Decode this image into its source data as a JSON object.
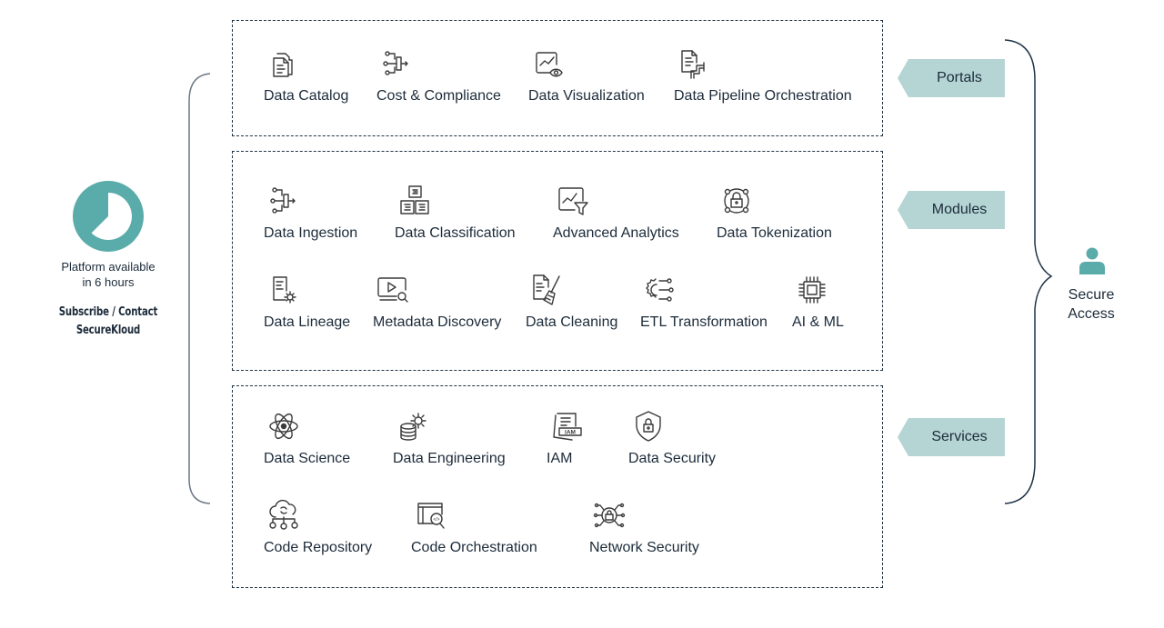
{
  "left_panel": {
    "clock_icon": "clock-pie-icon",
    "availability_text_line1": "Platform available",
    "availability_text_line2": "in 6 hours",
    "cta_line1": "Subscribe / Contact",
    "cta_line2": "SecureKloud"
  },
  "sections": {
    "portals": {
      "tag": "Portals",
      "items": [
        {
          "label": "Data Catalog",
          "icon": "documents-icon"
        },
        {
          "label": "Cost & Compliance",
          "icon": "pipeline-merge-icon"
        },
        {
          "label": "Data Visualization",
          "icon": "chart-eye-icon"
        },
        {
          "label": "Data Pipeline Orchestration",
          "icon": "document-pipe-icon"
        }
      ]
    },
    "modules": {
      "tag": "Modules",
      "items": [
        {
          "label": "Data Ingestion",
          "icon": "ingestion-icon"
        },
        {
          "label": "Data Classification",
          "icon": "classification-boxes-icon"
        },
        {
          "label": "Advanced Analytics",
          "icon": "chart-filter-icon"
        },
        {
          "label": "Data Tokenization",
          "icon": "lock-network-icon"
        },
        {
          "label": "Data Lineage",
          "icon": "document-gear-icon"
        },
        {
          "label": "Metadata Discovery",
          "icon": "video-search-icon"
        },
        {
          "label": "Data Cleaning",
          "icon": "document-broom-icon"
        },
        {
          "label": "ETL Transformation",
          "icon": "gear-nodes-icon"
        },
        {
          "label": "AI & ML",
          "icon": "chip-icon"
        }
      ]
    },
    "services": {
      "tag": "Services",
      "items": [
        {
          "label": "Data Science",
          "icon": "atom-icon"
        },
        {
          "label": "Data Engineering",
          "icon": "database-gear-icon"
        },
        {
          "label": "IAM",
          "icon": "iam-document-icon",
          "icon_text": "IAM"
        },
        {
          "label": "Data Security",
          "icon": "shield-lock-icon"
        },
        {
          "label": "Code Repository",
          "icon": "cloud-sync-icon"
        },
        {
          "label": "Code Orchestration",
          "icon": "code-window-search-icon",
          "icon_text": "</>"
        },
        {
          "label": "Network Security",
          "icon": "lock-circuit-icon"
        }
      ]
    }
  },
  "right_panel": {
    "icon": "user-icon",
    "label_line1": "Secure",
    "label_line2": "Access"
  },
  "colors": {
    "teal": "#5aacab",
    "tag_fill": "#b5d4d4",
    "text": "#1c2b3a",
    "border": "#1e3346"
  }
}
